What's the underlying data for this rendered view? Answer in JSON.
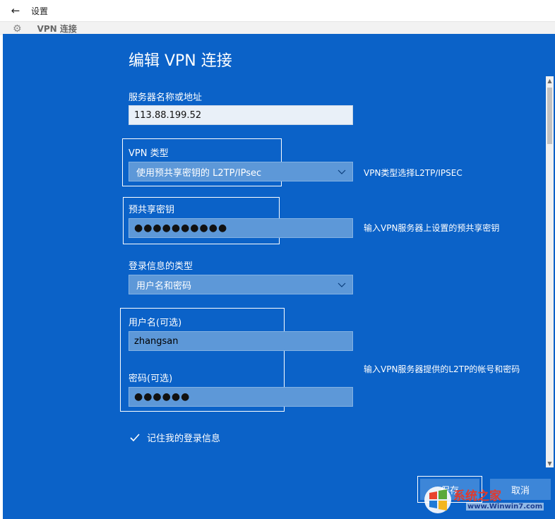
{
  "window": {
    "title": "设置",
    "back_icon": "back-arrow-icon",
    "behind_label": "VPN 连接"
  },
  "dialog": {
    "title": "编辑 VPN 连接",
    "server": {
      "label": "服务器名称或地址",
      "value": "113.88.199.52"
    },
    "vpn_type": {
      "label": "VPN 类型",
      "value": "使用预共享密钥的 L2TP/IPsec",
      "note": "VPN类型选择L2TP/IPSEC"
    },
    "psk": {
      "label": "预共享密钥",
      "value": "●●●●●●●●●●",
      "note": "输入VPN服务器上设置的预共享密钥"
    },
    "signin_type": {
      "label": "登录信息的类型",
      "value": "用户名和密码"
    },
    "username": {
      "label": "用户名(可选)",
      "value": "zhangsan"
    },
    "password": {
      "label": "密码(可选)",
      "value": "●●●●●●"
    },
    "credentials_note": "输入VPN服务器提供的L2TP的帐号和密码",
    "remember": {
      "label": "记住我的登录信息",
      "checked": true
    },
    "buttons": {
      "save": "保存",
      "cancel": "取消"
    }
  },
  "watermark": {
    "text": "系统之家",
    "url": "www.Winwin7.com"
  },
  "colors": {
    "dialog_bg": "#0b62c8",
    "field_bg": "#5d98d8",
    "input_bg": "#e9f0f8"
  }
}
